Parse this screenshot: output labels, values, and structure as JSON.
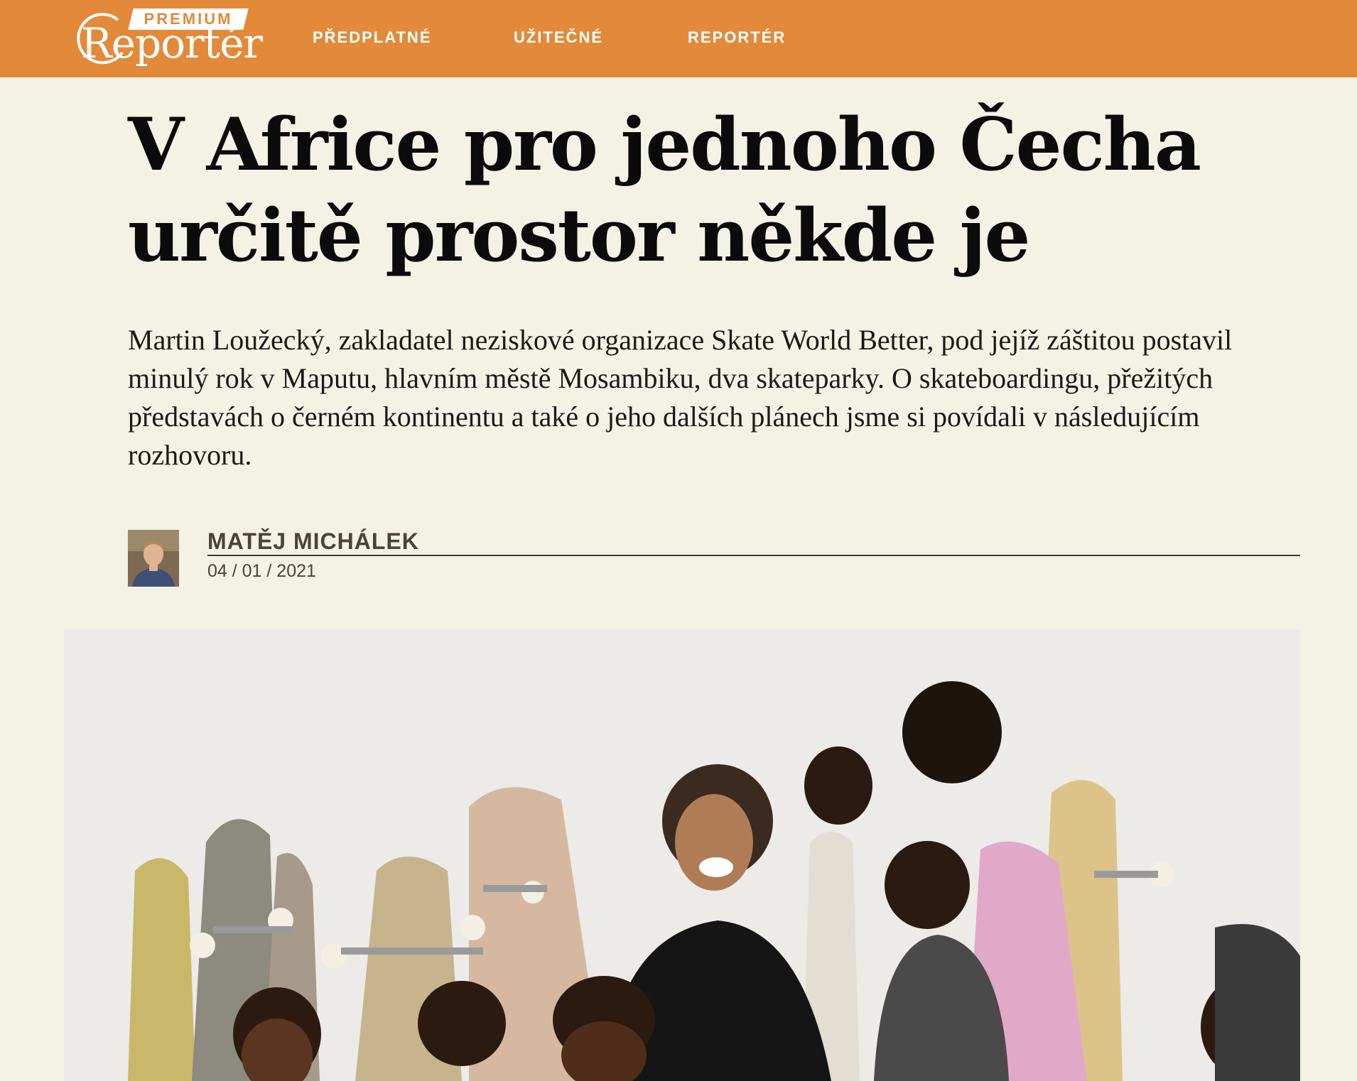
{
  "header": {
    "logo_badge": "PREMIUM",
    "logo_word": "Reportér",
    "nav": [
      {
        "label": "PŘEDPLATNÉ"
      },
      {
        "label": "UŽITEČNÉ"
      },
      {
        "label": "REPORTÉR"
      }
    ]
  },
  "article": {
    "headline": "V Africe pro jednoho Čecha určitě prostor někde je",
    "lede": "Martin Loužecký, zakladatel neziskové organizace Skate World Better, pod jejíž záštitou postavil minulý rok v Maputu, hlavním městě Mosambiku, dva skateparky. O skateboardingu, přežitých představách o černém kontinentu a také o jeho dalších plánech jsme si povídali v následujícím rozhovoru.",
    "author": "MATĚJ MICHÁLEK",
    "date": "04 / 01 / 2021"
  },
  "colors": {
    "header_bg": "#e28a3a",
    "page_bg": "#f4f2e4",
    "text": "#0b0b0b",
    "meta_text": "#4a4438"
  },
  "icons": {
    "logo": "reporter-circle-logo"
  }
}
